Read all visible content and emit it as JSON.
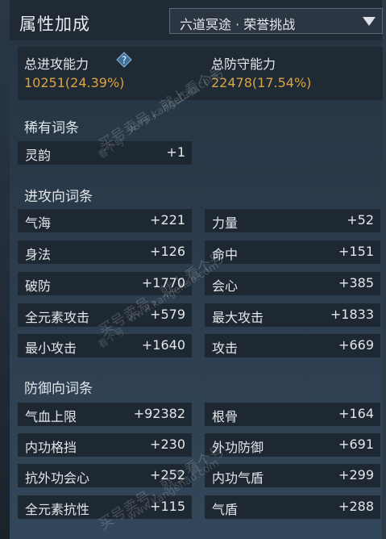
{
  "header": {
    "title": "属性加成",
    "dropdown_value": "六道冥途 · 荣誉挑战"
  },
  "summary": {
    "attack_label": "总进攻能力",
    "attack_value": "10251(24.39%)",
    "defense_label": "总防守能力",
    "defense_value": "22478(17.54%)"
  },
  "sections": {
    "rare": "稀有词条",
    "attack": "进攻向词条",
    "defense": "防御向词条"
  },
  "rare_rows": [
    {
      "label": "灵韵",
      "value": "+1"
    }
  ],
  "attack_rows": [
    {
      "label": "气海",
      "value": "+221"
    },
    {
      "label": "力量",
      "value": "+52"
    },
    {
      "label": "身法",
      "value": "+126"
    },
    {
      "label": "命中",
      "value": "+151"
    },
    {
      "label": "破防",
      "value": "+1770"
    },
    {
      "label": "会心",
      "value": "+385"
    },
    {
      "label": "全元素攻击",
      "value": "+579"
    },
    {
      "label": "最大攻击",
      "value": "+1833"
    },
    {
      "label": "最小攻击",
      "value": "+1640"
    },
    {
      "label": "攻击",
      "value": "+669"
    }
  ],
  "defense_rows": [
    {
      "label": "气血上限",
      "value": "+92382"
    },
    {
      "label": "根骨",
      "value": "+164"
    },
    {
      "label": "内功格挡",
      "value": "+230"
    },
    {
      "label": "外功防御",
      "value": "+691"
    },
    {
      "label": "抗外功会心",
      "value": "+252"
    },
    {
      "label": "内功气盾",
      "value": "+299"
    },
    {
      "label": "全元素抗性",
      "value": "+115"
    },
    {
      "label": "气盾",
      "value": "+288"
    }
  ],
  "watermarks": {
    "text_cn": "买号卖号，就上看个号",
    "text_url": "www.kangehao.com",
    "text_logo": "看个号"
  },
  "colors": {
    "accent_gold": "#d9a544",
    "row_bg": "#1e2832",
    "panel_bg": "#2b3b4b"
  },
  "icons": {
    "help": "help-diamond-icon",
    "dropdown": "triangle-down-icon"
  }
}
